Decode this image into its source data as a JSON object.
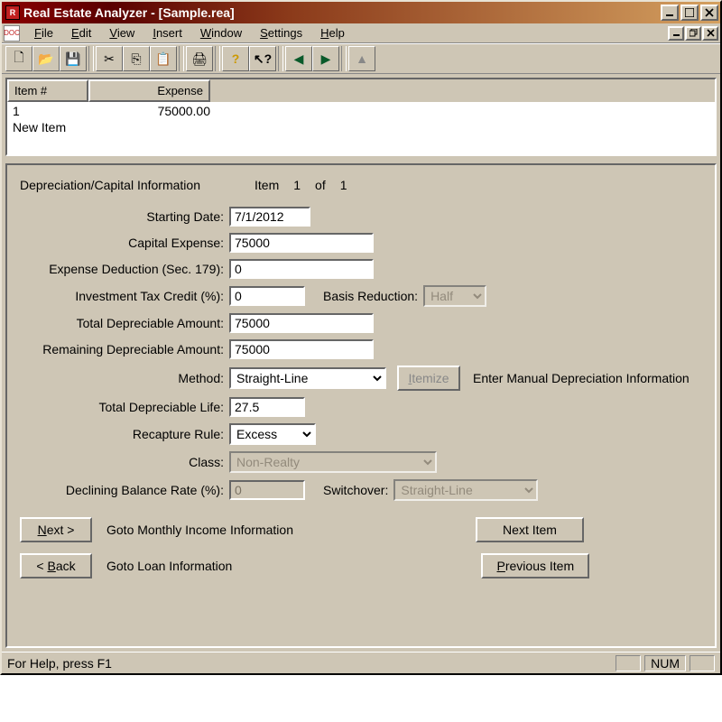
{
  "window": {
    "title": "Real Estate Analyzer - [Sample.rea]"
  },
  "menu": {
    "file": "File",
    "edit": "Edit",
    "view": "View",
    "insert": "Insert",
    "windowm": "Window",
    "settings": "Settings",
    "help": "Help"
  },
  "table": {
    "headers": {
      "item": "Item #",
      "expense": "Expense"
    },
    "rows": [
      {
        "item": "1",
        "expense": "75000.00"
      },
      {
        "item": "New Item",
        "expense": ""
      }
    ]
  },
  "form": {
    "section_title": "Depreciation/Capital Information",
    "item_label": "Item",
    "item_cur": "1",
    "item_of": "of",
    "item_tot": "1",
    "labels": {
      "starting_date": "Starting Date:",
      "capital_expense": "Capital Expense:",
      "expense_deduction": "Expense Deduction (Sec. 179):",
      "itc": "Investment Tax Credit (%):",
      "basis_reduction": "Basis Reduction:",
      "tda": "Total Depreciable Amount:",
      "rda": "Remaining Depreciable Amount:",
      "method": "Method:",
      "itemize": "Itemize",
      "itemize_hint": "Enter Manual Depreciation Information",
      "tdl": "Total Depreciable Life:",
      "recapture": "Recapture Rule:",
      "class": "Class:",
      "dbr": "Declining Balance Rate (%):",
      "switchover": "Switchover:"
    },
    "values": {
      "starting_date": "7/1/2012",
      "capital_expense": "75000",
      "expense_deduction": "0",
      "itc": "0",
      "basis_reduction": "Half",
      "tda": "75000",
      "rda": "75000",
      "method": "Straight-Line",
      "tdl": "27.5",
      "recapture": "Excess",
      "class": "Non-Realty",
      "dbr": "0",
      "switchover": "Straight-Line"
    },
    "nav": {
      "next": "Next >",
      "next_hint": "Goto Monthly Income Information",
      "back": "< Back",
      "back_hint": "Goto Loan Information",
      "next_item": "Next Item",
      "prev_item": "Previous Item"
    }
  },
  "status": {
    "help": "For Help, press F1",
    "num": "NUM"
  }
}
